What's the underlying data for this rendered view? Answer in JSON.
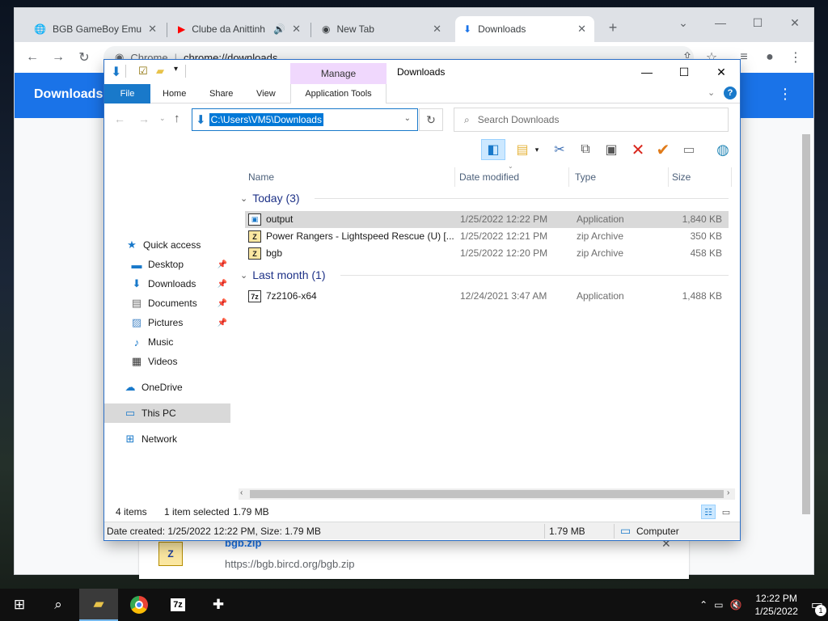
{
  "chrome": {
    "tabs": [
      {
        "label": "BGB GameBoy Emulat",
        "icon": "globe-icon"
      },
      {
        "label": "Clube da Anittinh",
        "icon": "youtube-icon"
      },
      {
        "label": "New Tab",
        "icon": "chrome-icon"
      },
      {
        "label": "Downloads",
        "icon": "download-icon"
      }
    ],
    "new_tab_glyph": "+",
    "omnibox_site": "Chrome",
    "omnibox_url": "chrome://downloads",
    "page_title": "Downloads",
    "download_card": {
      "filename": "bgb.zip",
      "url": "https://bgb.bircd.org/bgb.zip"
    }
  },
  "explorer": {
    "context_tab": "Manage",
    "window_title": "Downloads",
    "ribbon_tabs": [
      "File",
      "Home",
      "Share",
      "View",
      "Application Tools"
    ],
    "address": "C:\\Users\\VM5\\Downloads",
    "search_placeholder": "Search Downloads",
    "columns": [
      "Name",
      "Date modified",
      "Type",
      "Size"
    ],
    "nav": {
      "quick_access": "Quick access",
      "desktop": "Desktop",
      "downloads": "Downloads",
      "documents": "Documents",
      "pictures": "Pictures",
      "music": "Music",
      "videos": "Videos",
      "onedrive": "OneDrive",
      "this_pc": "This PC",
      "network": "Network"
    },
    "groups": [
      {
        "label": "Today (3)",
        "files": [
          {
            "name": "output",
            "date": "1/25/2022 12:22 PM",
            "type": "Application",
            "size": "1,840 KB",
            "selected": true
          },
          {
            "name": "Power Rangers - Lightspeed Rescue (U) [...",
            "date": "1/25/2022 12:21 PM",
            "type": "zip Archive",
            "size": "350 KB",
            "selected": false
          },
          {
            "name": "bgb",
            "date": "1/25/2022 12:20 PM",
            "type": "zip Archive",
            "size": "458 KB",
            "selected": false
          }
        ]
      },
      {
        "label": "Last month (1)",
        "files": [
          {
            "name": "7z2106-x64",
            "date": "12/24/2021 3:47 AM",
            "type": "Application",
            "size": "1,488 KB",
            "selected": false
          }
        ]
      }
    ],
    "status": {
      "items": "4 items",
      "selected": "1 item selected",
      "size": "1.79 MB"
    },
    "details": {
      "info": "Date created: 1/25/2022 12:22 PM, Size: 1.79 MB",
      "size": "1.79 MB",
      "location": "Computer"
    }
  },
  "taskbar": {
    "time": "12:22 PM",
    "date": "1/25/2022",
    "notifications": "1"
  }
}
